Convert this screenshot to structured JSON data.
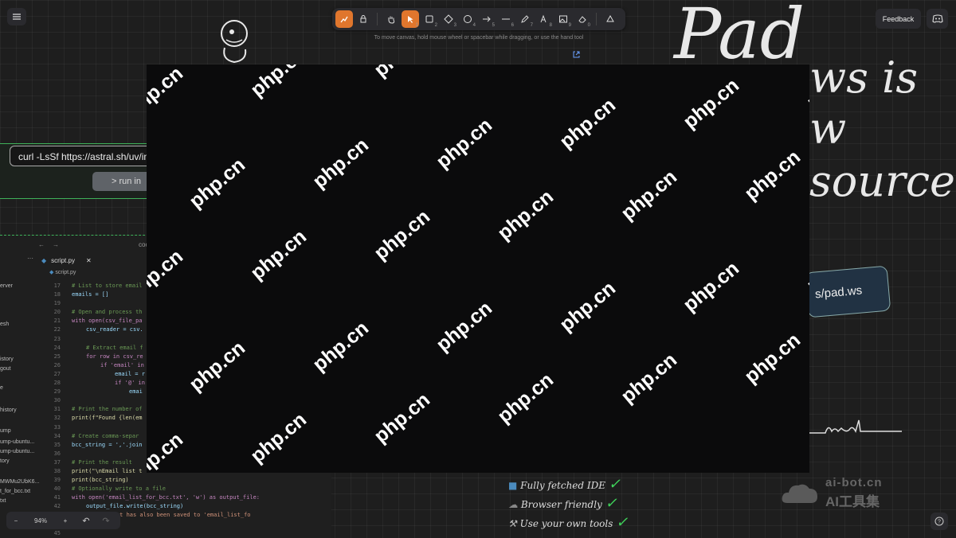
{
  "toolbar": {
    "hint": "To move canvas, hold mouse wheel or spacebar while dragging, or use the hand tool",
    "keys": [
      "1",
      "2",
      "3",
      "4",
      "5",
      "6",
      "7",
      "8",
      "9",
      "0"
    ]
  },
  "header": {
    "feedback_label": "Feedback"
  },
  "curl_card": {
    "command": "curl -LsSf https://astral.sh/uv/in",
    "run_label": "> run in"
  },
  "canvas_text": {
    "pad_heading": "Pad",
    "line1": "ws is",
    "line2": "w",
    "line3": "source",
    "url_pill": "s/pad.ws"
  },
  "features": [
    {
      "icon": "cube-icon",
      "label": "Fully fetched IDE"
    },
    {
      "icon": "cloud-icon",
      "label": "Browser friendly"
    },
    {
      "icon": "tools-icon",
      "label": "Use your own tools"
    }
  ],
  "editor": {
    "nav_path": "coo",
    "tab_label": "script.py",
    "breadcrumb": "script.py",
    "sidebar": [
      "erver",
      "esh",
      "istory",
      "gout",
      "e",
      "history",
      "ump",
      "ump-ubuntu...",
      "ump-ubuntu...",
      "tory",
      "MWMu2UbK6...",
      "t_for_bcc.txt",
      "txt"
    ],
    "code": [
      {
        "n": "17",
        "t": "# List to store email",
        "c": "c-com",
        "ind": 0
      },
      {
        "n": "18",
        "t": "emails = []",
        "c": "c-id",
        "ind": 0
      },
      {
        "n": "19",
        "t": "",
        "c": "c-id",
        "ind": 0
      },
      {
        "n": "20",
        "t": "# Open and process th",
        "c": "c-com",
        "ind": 0
      },
      {
        "n": "21",
        "t": "with open(csv_file_pa",
        "c": "c-kw",
        "ind": 0
      },
      {
        "n": "22",
        "t": "csv_reader = csv.",
        "c": "c-id",
        "ind": 1
      },
      {
        "n": "23",
        "t": "",
        "c": "c-id",
        "ind": 0
      },
      {
        "n": "24",
        "t": "# Extract email f",
        "c": "c-com",
        "ind": 1
      },
      {
        "n": "25",
        "t": "for row in csv_re",
        "c": "c-kw",
        "ind": 1
      },
      {
        "n": "26",
        "t": "if 'email' in",
        "c": "c-kw",
        "ind": 2
      },
      {
        "n": "27",
        "t": "email = r",
        "c": "c-id",
        "ind": 3
      },
      {
        "n": "28",
        "t": "if '@' in",
        "c": "c-kw",
        "ind": 3
      },
      {
        "n": "29",
        "t": "emai",
        "c": "c-id",
        "ind": 4
      },
      {
        "n": "30",
        "t": "",
        "c": "c-id",
        "ind": 0
      },
      {
        "n": "31",
        "t": "# Print the number of",
        "c": "c-com",
        "ind": 0
      },
      {
        "n": "32",
        "t": "print(f\"Found {len(em",
        "c": "c-fn",
        "ind": 0
      },
      {
        "n": "33",
        "t": "",
        "c": "c-id",
        "ind": 0
      },
      {
        "n": "34",
        "t": "# Create comma-separ",
        "c": "c-com",
        "ind": 0
      },
      {
        "n": "35",
        "t": "bcc_string = ','.join",
        "c": "c-id",
        "ind": 0
      },
      {
        "n": "36",
        "t": "",
        "c": "c-id",
        "ind": 0
      },
      {
        "n": "37",
        "t": "# Print the result",
        "c": "c-com",
        "ind": 0
      },
      {
        "n": "38",
        "t": "print(\"\\nEmail list t",
        "c": "c-fn",
        "ind": 0
      },
      {
        "n": "39",
        "t": "print(bcc_string)",
        "c": "c-fn",
        "ind": 0
      },
      {
        "n": "40",
        "t": "# Optionally write to a file",
        "c": "c-com",
        "ind": 0
      },
      {
        "n": "41",
        "t": "with open('email_list_for_bcc.txt', 'w') as output_file:",
        "c": "c-kw",
        "ind": 0
      },
      {
        "n": "42",
        "t": "output_file.write(bcc_string)",
        "c": "c-id",
        "ind": 1
      },
      {
        "n": "43",
        "t": "nEmail list has also been saved to 'email_list_fo",
        "c": "c-str",
        "ind": 1
      },
      {
        "n": "44",
        "t": "",
        "c": "c-id",
        "ind": 0
      },
      {
        "n": "45",
        "t": "",
        "c": "c-id",
        "ind": 0
      }
    ]
  },
  "zoom": {
    "minus": "−",
    "level": "94%",
    "plus": "+",
    "undo": "↶",
    "redo": "↷"
  },
  "overlay": {
    "watermark": "php.cn"
  },
  "logo_watermark": {
    "line1": "ai-bot.cn",
    "line2": "AI工具集"
  },
  "colors": {
    "accent": "#e0762d",
    "green": "#3fd25a",
    "background": "#1e1e1e"
  }
}
